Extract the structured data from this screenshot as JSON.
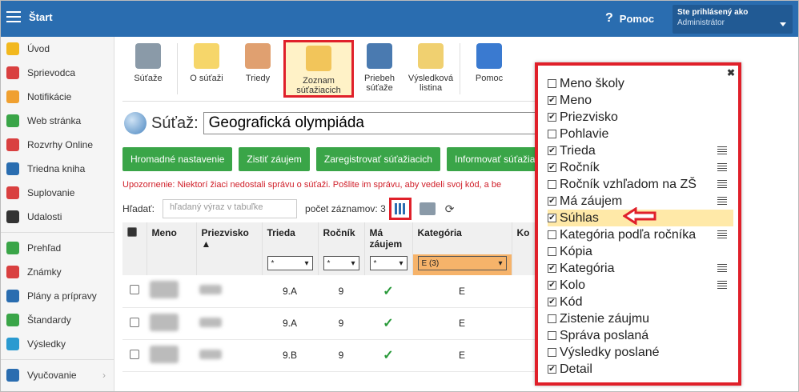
{
  "topbar": {
    "title": "Štart",
    "help_label": "Pomoc",
    "user_line1": "Ste prihlásený ako",
    "user_line2": "Administrátor"
  },
  "sidebar": {
    "items": [
      {
        "label": "Úvod",
        "color": "#f2b81e"
      },
      {
        "label": "Sprievodca",
        "color": "#d94040"
      },
      {
        "label": "Notifikácie",
        "color": "#f0a030"
      },
      {
        "label": "Web stránka",
        "color": "#3aa548"
      },
      {
        "label": "Rozvrhy Online",
        "color": "#d94040"
      },
      {
        "label": "Triedna kniha",
        "color": "#2a6db0"
      },
      {
        "label": "Suplovanie",
        "color": "#d94040"
      },
      {
        "label": "Udalosti",
        "color": "#333333"
      }
    ],
    "items2": [
      {
        "label": "Prehľad",
        "color": "#3aa548"
      },
      {
        "label": "Známky",
        "color": "#d94040"
      },
      {
        "label": "Plány a prípravy",
        "color": "#2a6db0"
      },
      {
        "label": "Štandardy",
        "color": "#3aa548"
      },
      {
        "label": "Výsledky",
        "color": "#2a9ad0"
      }
    ],
    "items3": [
      {
        "label": "Vyučovanie",
        "color": "#2a6db0"
      }
    ]
  },
  "toolbar": [
    {
      "label": "Súťaže",
      "color": "#8a9aa8"
    },
    {
      "label": "O súťaži",
      "color": "#f6d66a"
    },
    {
      "label": "Triedy",
      "color": "#e0a070"
    },
    {
      "label": "Zoznam súťažiacich",
      "color": "#f2c55a",
      "active": true
    },
    {
      "label": "Priebeh súťaže",
      "color": "#4a7ab0"
    },
    {
      "label": "Výsledková listina",
      "color": "#f0d070"
    },
    {
      "label": "Pomoc",
      "color": "#3a7ad0"
    }
  ],
  "contest": {
    "label": "Súťaž:",
    "value": "Geografická olympiáda"
  },
  "buttons": [
    "Hromadné nastavenie",
    "Zistiť záujem",
    "Zaregistrovať súťažiacich",
    "Informovať súťažia"
  ],
  "warning": "Upozornenie: Niektorí žiaci nedostali správu o súťaži. Pošlite im správu, aby vedeli svoj kód, a be",
  "filter": {
    "label": "Hľadať:",
    "placeholder": "hľadaný výraz v tabuľke",
    "count_label": "počet záznamov: 3"
  },
  "table": {
    "headers": [
      "Meno",
      "Priezvisko ▲",
      "Trieda",
      "Ročník",
      "Má záujem",
      "Kategória",
      "Ko"
    ],
    "filters": [
      "*",
      "*",
      "*",
      "E (3)"
    ],
    "rows": [
      {
        "trieda": "9.A",
        "rocnik": "9",
        "zaujem": "✓",
        "kategoria": "E"
      },
      {
        "trieda": "9.A",
        "rocnik": "9",
        "zaujem": "✓",
        "kategoria": "E"
      },
      {
        "trieda": "9.B",
        "rocnik": "9",
        "zaujem": "✓",
        "kategoria": "E"
      }
    ]
  },
  "columns_panel": {
    "items": [
      {
        "label": "Meno školy",
        "checked": false,
        "drag": false
      },
      {
        "label": "Meno",
        "checked": true,
        "drag": false
      },
      {
        "label": "Priezvisko",
        "checked": true,
        "drag": false
      },
      {
        "label": "Pohlavie",
        "checked": false,
        "drag": false
      },
      {
        "label": "Trieda",
        "checked": true,
        "drag": true
      },
      {
        "label": "Ročník",
        "checked": true,
        "drag": true
      },
      {
        "label": "Ročník vzhľadom na ZŠ",
        "checked": false,
        "drag": true
      },
      {
        "label": "Má záujem",
        "checked": true,
        "drag": true
      },
      {
        "label": "Súhlas",
        "checked": true,
        "drag": false,
        "highlight": true
      },
      {
        "label": "Kategória podľa ročníka",
        "checked": false,
        "drag": true
      },
      {
        "label": "Kópia",
        "checked": false,
        "drag": false
      },
      {
        "label": "Kategória",
        "checked": true,
        "drag": true
      },
      {
        "label": "Kolo",
        "checked": true,
        "drag": true
      },
      {
        "label": "Kód",
        "checked": true,
        "drag": false
      },
      {
        "label": "Zistenie záujmu",
        "checked": false,
        "drag": false
      },
      {
        "label": "Správa poslaná",
        "checked": false,
        "drag": false
      },
      {
        "label": "Výsledky poslané",
        "checked": false,
        "drag": false
      },
      {
        "label": "Detail",
        "checked": true,
        "drag": false
      }
    ]
  }
}
